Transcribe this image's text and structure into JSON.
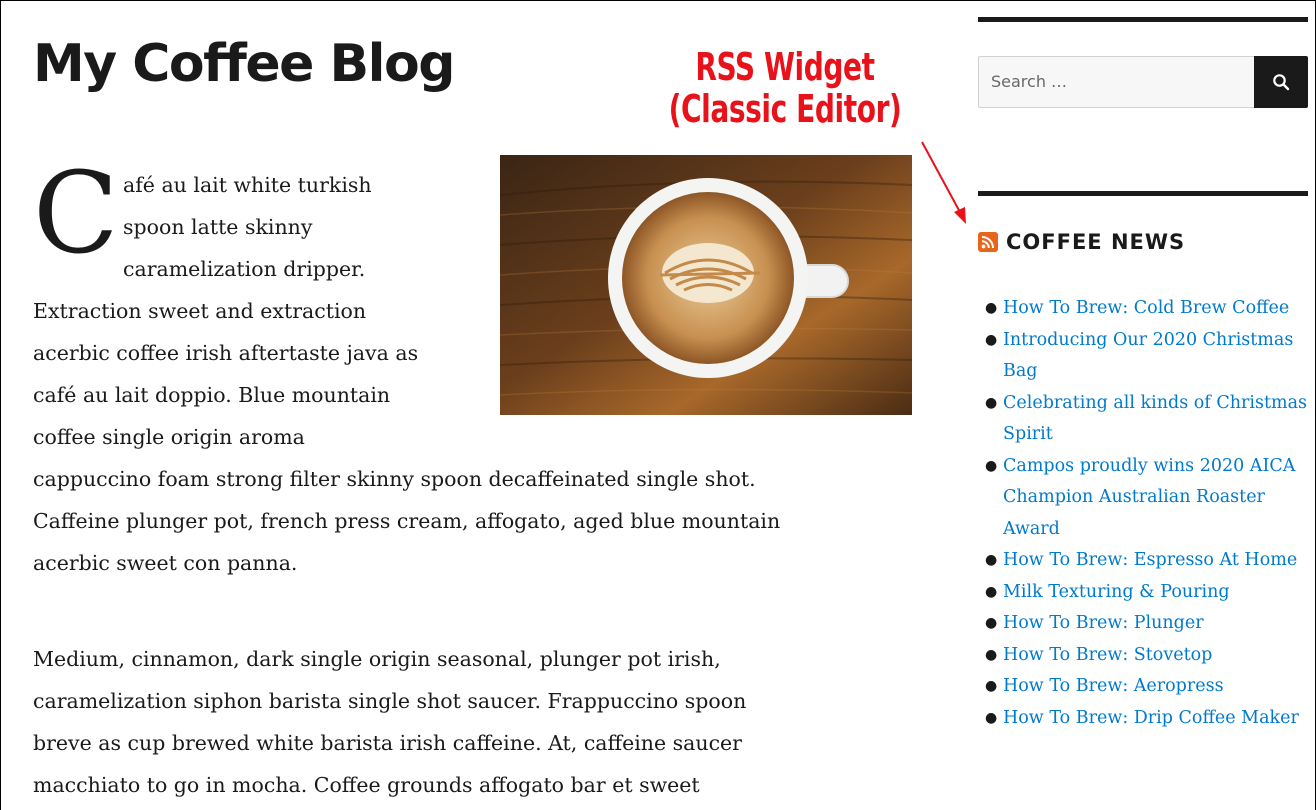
{
  "site": {
    "title": "My Coffee Blog"
  },
  "annotation": {
    "line1": "RSS Widget",
    "line2": "(Classic Editor)",
    "color": "#e8121b"
  },
  "post": {
    "dropcap": "C",
    "paragraph1_lines": [
      "afé au lait white turkish",
      "spoon latte skinny",
      "caramelization dripper.",
      "Extraction sweet and extraction",
      "acerbic coffee irish aftertaste java as",
      "café au lait doppio. Blue mountain",
      "coffee single origin aroma",
      "cappuccino foam strong filter skinny spoon decaffeinated single shot.",
      "Caffeine plunger pot, french press cream, affogato, aged blue mountain",
      "acerbic sweet con panna."
    ],
    "paragraph2_lines": [
      "Medium, cinnamon, dark single origin seasonal, plunger pot irish,",
      "caramelization siphon barista single shot saucer. Frappuccino spoon",
      "breve as cup brewed white barista irish caffeine. At, caffeine saucer",
      "macchiato to go in mocha. Coffee grounds affogato bar et sweet"
    ],
    "image_icon": "latte-art-coffee-cup-image"
  },
  "sidebar": {
    "search": {
      "placeholder": "Search …",
      "button_icon": "search-icon"
    },
    "widget": {
      "icon": "rss-icon",
      "title": "COFFEE NEWS",
      "items": [
        "How To Brew: Cold Brew Coffee",
        "Introducing Our 2020 Christmas Bag",
        "Celebrating all kinds of Christmas Spirit",
        "Campos proudly wins 2020 AICA Champion Australian Roaster Award",
        "How To Brew: Espresso At Home",
        "Milk Texturing & Pouring",
        "How To Brew: Plunger",
        "How To Brew: Stovetop",
        "How To Brew: Aeropress",
        "How To Brew: Drip Coffee Maker"
      ]
    }
  },
  "colors": {
    "link": "#007acc",
    "text": "#1a1a1a",
    "search_button": "#1a1a1a"
  }
}
